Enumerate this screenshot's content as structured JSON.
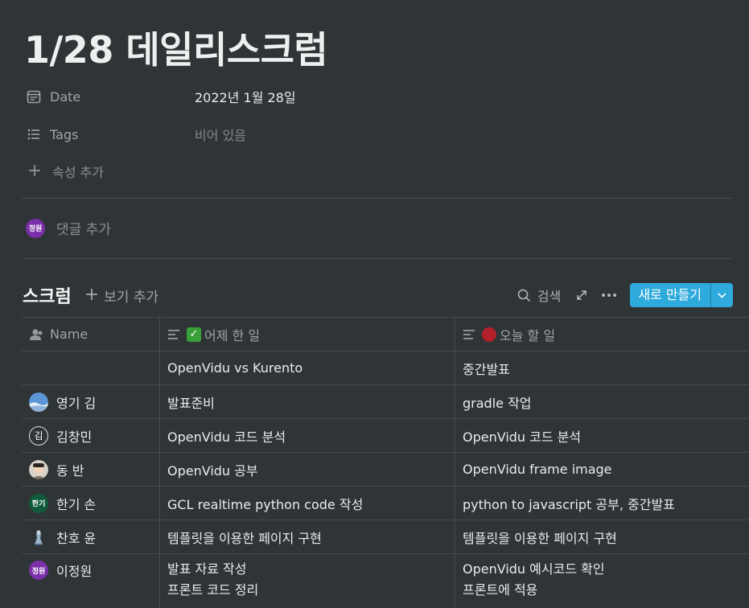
{
  "page": {
    "title": "1/28 데일리스크럼"
  },
  "properties": [
    {
      "icon": "calendar-icon",
      "label": "Date",
      "value": "2022년 1월 28일"
    },
    {
      "icon": "list-icon",
      "label": "Tags",
      "value": "비어 있음"
    }
  ],
  "add_property_label": "속성 추가",
  "comment": {
    "avatar_text": "정원",
    "placeholder": "댓글 추가"
  },
  "database": {
    "title": "스크럼",
    "add_view_label": "보기 추가",
    "search_label": "검색",
    "new_button_label": "새로 만들기",
    "columns": [
      {
        "icon": "person-icon",
        "label": "Name"
      },
      {
        "icon": "text-lines-icon",
        "emoji": "✅",
        "label": "어제 한 일"
      },
      {
        "icon": "text-lines-icon",
        "emoji": "red-circle",
        "label": "오늘 할 일"
      }
    ],
    "rows": [
      {
        "name": "",
        "avatar": "",
        "yesterday": [
          "OpenVidu vs Kurento"
        ],
        "today": [
          "중간발표"
        ]
      },
      {
        "name": "영기 김",
        "avatar": "landscape",
        "yesterday": [
          "발표준비"
        ],
        "today": [
          "gradle 작업"
        ]
      },
      {
        "name": "김창민",
        "avatar": "김",
        "yesterday": [
          "OpenVidu 코드 분석"
        ],
        "today": [
          "OpenVidu 코드 분석"
        ]
      },
      {
        "name": "동 반",
        "avatar": "photo",
        "yesterday": [
          "OpenVidu 공부"
        ],
        "today": [
          "OpenVidu frame image"
        ]
      },
      {
        "name": "한기 손",
        "avatar": "한기",
        "yesterday": [
          "GCL realtime python code 작성"
        ],
        "today": [
          "python to javascript 공부, 중간발표"
        ]
      },
      {
        "name": "찬호 윤",
        "avatar": "figure",
        "yesterday": [
          "템플릿을 이용한 페이지 구현"
        ],
        "today": [
          "템플릿을 이용한 페이지 구현"
        ]
      },
      {
        "name": "이정원",
        "avatar": "정원",
        "yesterday": [
          "발표 자료 작성",
          "프론트 코드 정리"
        ],
        "today": [
          "OpenVidu 예시코드 확인",
          "프론트에 적용"
        ]
      }
    ]
  },
  "colors": {
    "background": "#2f3437",
    "accent": "#2eaadc"
  }
}
